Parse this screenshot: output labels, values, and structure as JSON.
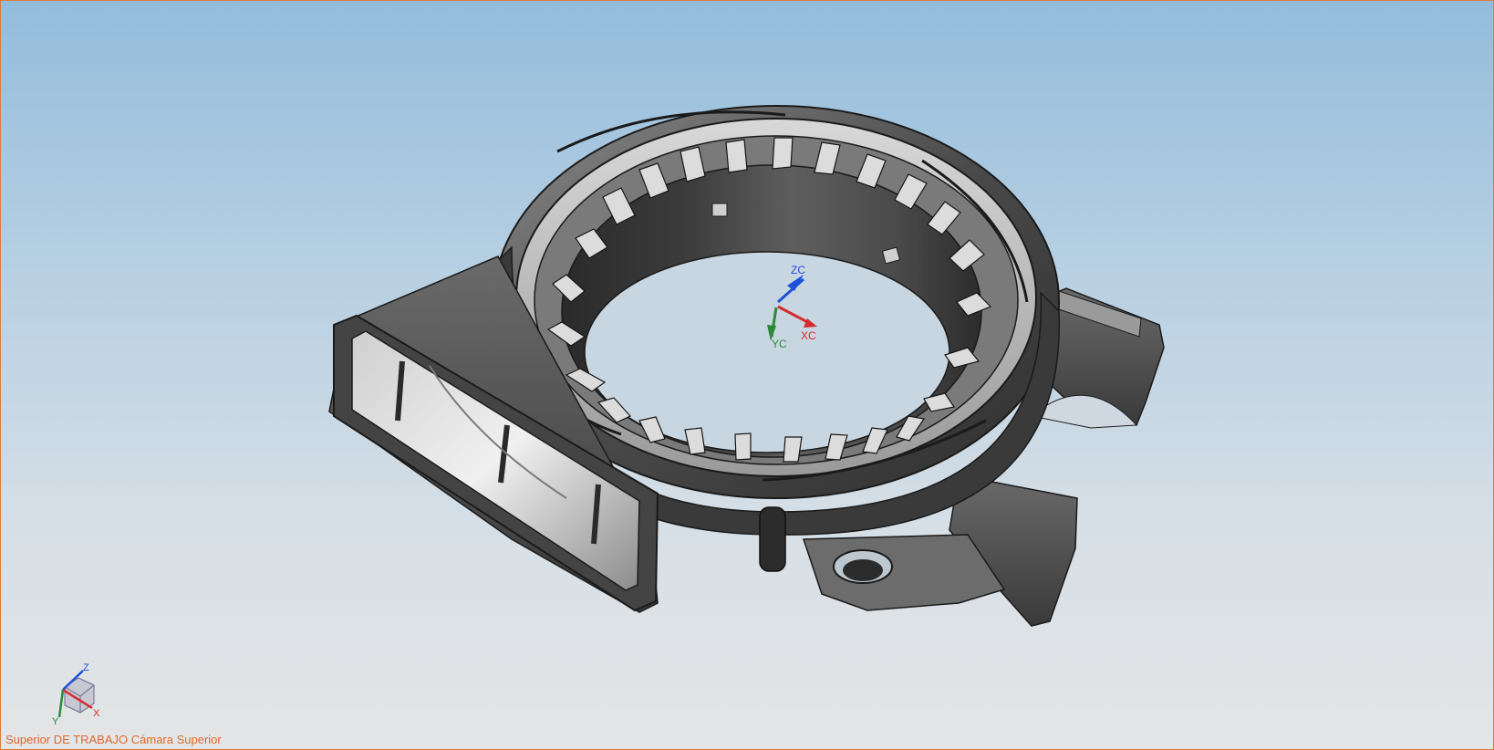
{
  "viewport": {
    "view_label": "Superior DE TRABAJO Cámara Superior",
    "background_top": "#93bcdc",
    "background_bottom": "#e4e5e6",
    "border_color": "#e07a3a"
  },
  "wcs_triad": {
    "zc_label": "ZC",
    "xc_label": "XC",
    "yc_label": "YC",
    "zc_color": "#1e4fd8",
    "xc_color": "#d62b2b",
    "yc_color": "#2a8a3a"
  },
  "view_triad": {
    "z_label": "Z",
    "x_label": "X",
    "y_label": "Y"
  },
  "model": {
    "name": "gray-ring-housing",
    "body_color": "#5a5a5a",
    "highlight_color": "#bfbfbf"
  }
}
